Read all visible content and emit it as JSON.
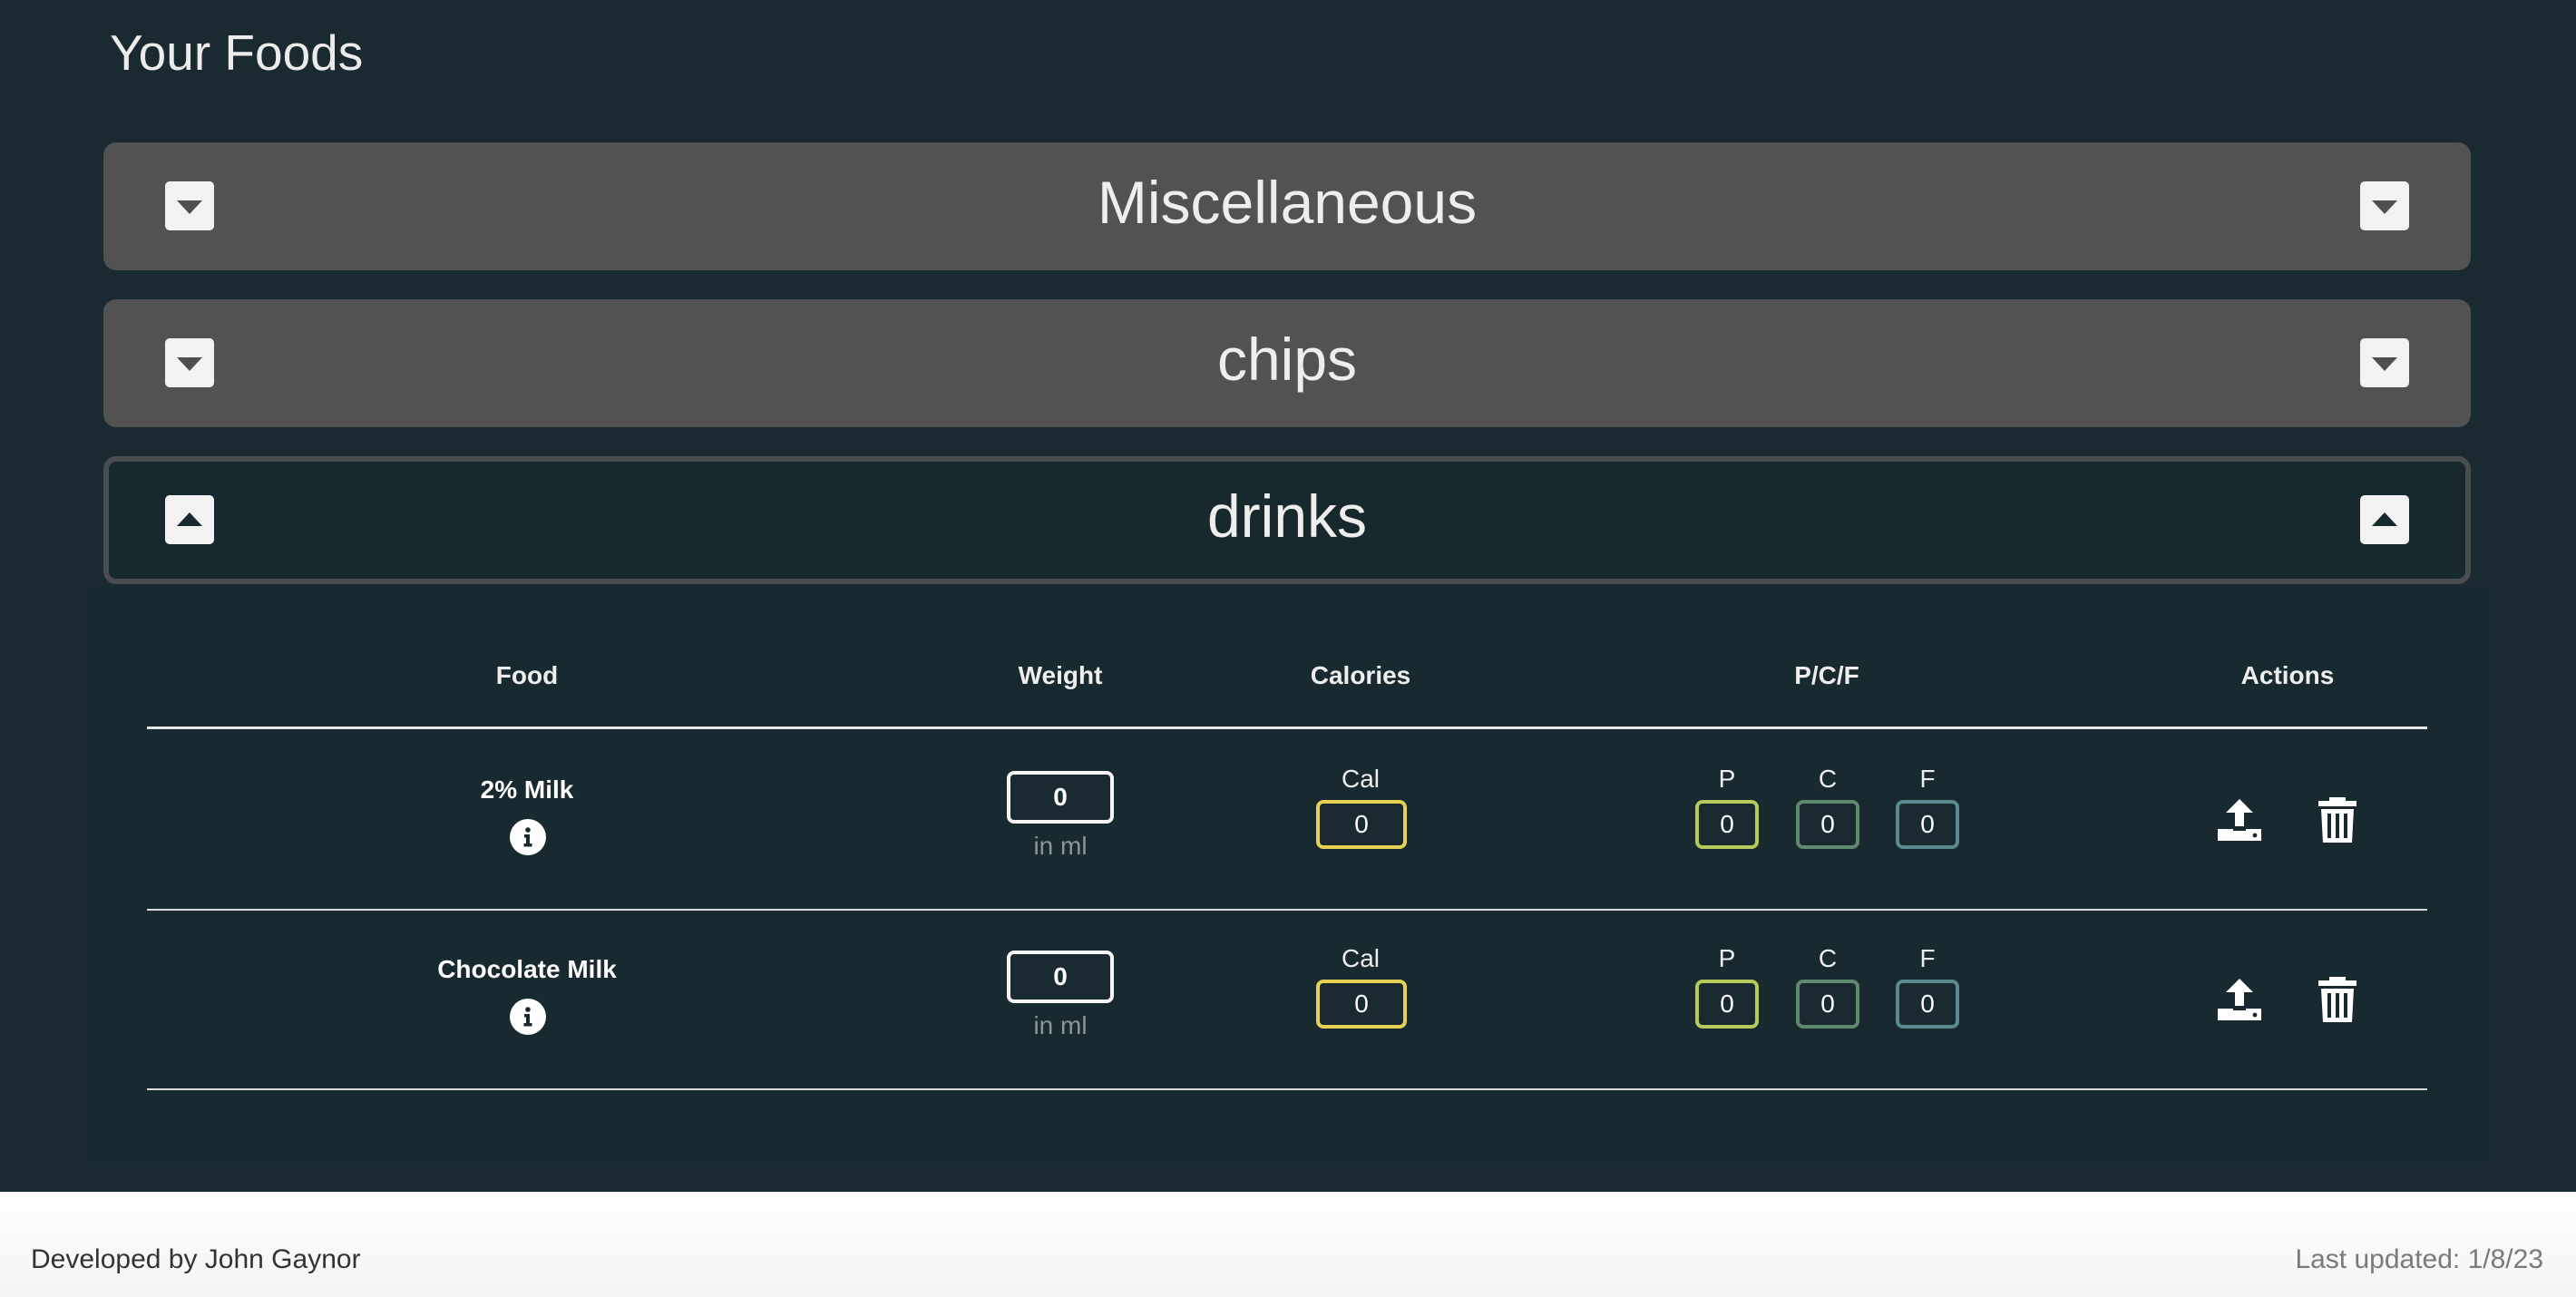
{
  "page": {
    "title": "Your Foods"
  },
  "categories": [
    {
      "name": "Miscellaneous",
      "expanded": false,
      "toggle_icon": "caret-down-icon"
    },
    {
      "name": "chips",
      "expanded": false,
      "toggle_icon": "caret-down-icon"
    },
    {
      "name": "drinks",
      "expanded": true,
      "toggle_icon": "caret-up-icon"
    }
  ],
  "table": {
    "columns": [
      "Food",
      "Weight",
      "Calories",
      "P/C/F",
      "Actions"
    ],
    "rows": [
      {
        "food": "2% Milk",
        "weight": "0",
        "unit_label": "in ml",
        "cal_label": "Cal",
        "calories": "0",
        "p_label": "P",
        "c_label": "C",
        "f_label": "F",
        "protein": "0",
        "carbs": "0",
        "fat": "0"
      },
      {
        "food": "Chocolate Milk",
        "weight": "0",
        "unit_label": "in ml",
        "cal_label": "Cal",
        "calories": "0",
        "p_label": "P",
        "c_label": "C",
        "f_label": "F",
        "protein": "0",
        "carbs": "0",
        "fat": "0"
      }
    ],
    "row_icons": [
      "info-icon",
      "upload-icon",
      "trash-icon"
    ]
  },
  "colors": {
    "background": "#1a2a30",
    "collapsed_category": "#525252",
    "calories_border": "#e6d252",
    "protein_border": "#b7c95a",
    "carbs_border": "#5c8a6d",
    "fat_border": "#5b8a8e"
  },
  "footer": {
    "developer": "Developed by John Gaynor",
    "last_updated": "Last updated: 1/8/23"
  }
}
